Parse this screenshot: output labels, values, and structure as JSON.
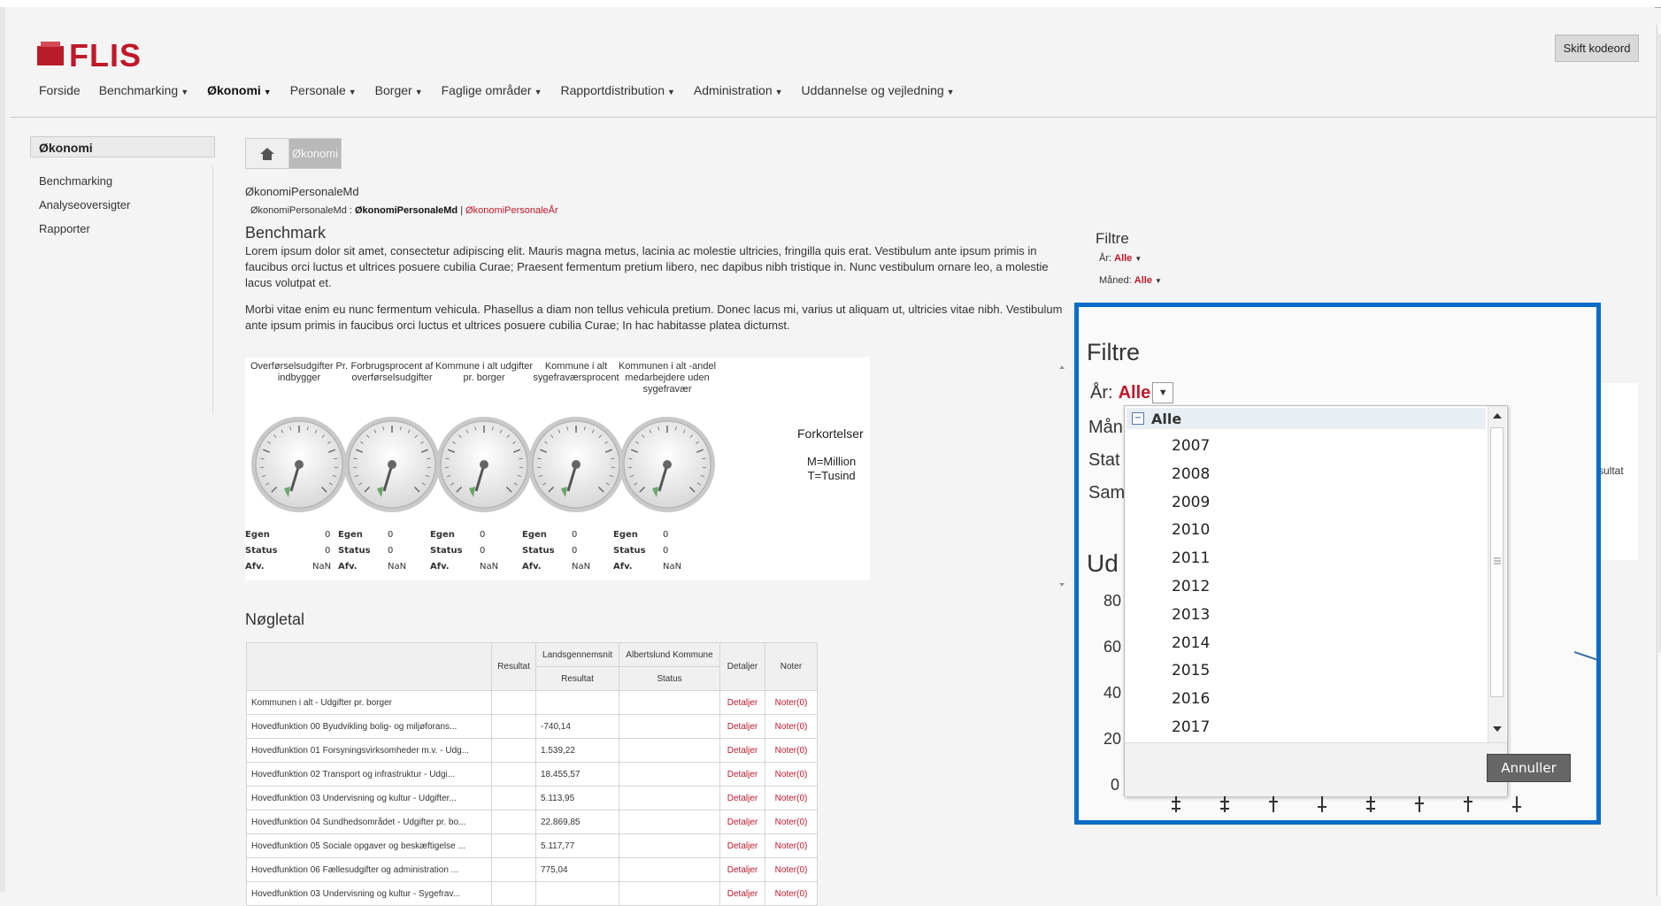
{
  "brand": {
    "name": "FLIS"
  },
  "header": {
    "switch_button": "Skift kodeord"
  },
  "nav": {
    "items": [
      {
        "label": "Forside",
        "caret": false,
        "active": false
      },
      {
        "label": "Benchmarking",
        "caret": true,
        "active": false
      },
      {
        "label": "Økonomi",
        "caret": true,
        "active": true
      },
      {
        "label": "Personale",
        "caret": true,
        "active": false
      },
      {
        "label": "Borger",
        "caret": true,
        "active": false
      },
      {
        "label": "Faglige områder",
        "caret": true,
        "active": false
      },
      {
        "label": "Rapportdistribution",
        "caret": true,
        "active": false
      },
      {
        "label": "Administration",
        "caret": true,
        "active": false
      },
      {
        "label": "Uddannelse og vejledning",
        "caret": true,
        "active": false
      }
    ]
  },
  "sidebar": {
    "title": "Økonomi",
    "items": [
      {
        "label": "Benchmarking"
      },
      {
        "label": "Analyseoversigter"
      },
      {
        "label": "Rapporter"
      }
    ]
  },
  "breadcrumb": {
    "current": "Økonomi"
  },
  "page": {
    "title": "ØkonomiPersonaleMd",
    "subtitle_prefix": "ØkonomiPersonaleMd : ",
    "subtitle_bold": "ØkonomiPersonaleMd",
    "subtitle_sep": " | ",
    "subtitle_link": "ØkonomiPersonaleÅr"
  },
  "benchmark": {
    "heading": "Benchmark",
    "para1": "Lorem ipsum dolor sit amet, consectetur adipiscing elit. Mauris magna metus, lacinia ac molestie ultricies, fringilla quis erat. Vestibulum ante ipsum primis in faucibus orci luctus et ultrices posuere cubilia Curae; Praesent fermentum pretium libero, nec dapibus nibh tristique in. Nunc vestibulum ornare leo, a molestie lacus volutpat et.",
    "para2": "Morbi vitae enim eu nunc fermentum vehicula. Phasellus a diam non tellus vehicula pretium. Donec lacus mi, varius ut aliquam ut, ultricies vitae nibh. Vestibulum ante ipsum primis in faucibus orci luctus et ultrices posuere cubilia Curae; In hac habitasse platea dictumst."
  },
  "gauges": [
    {
      "title": "Overførselsudgifter Pr. indbygger",
      "egen": "0",
      "status": "0",
      "afv": "NaN"
    },
    {
      "title": "Forbrugsprocent af overførselsudgifter",
      "egen": "0",
      "status": "0",
      "afv": "NaN"
    },
    {
      "title": "Kommune i alt udgifter pr. borger",
      "egen": "0",
      "status": "0",
      "afv": "NaN"
    },
    {
      "title": "Kommune i alt sygefraværsprocent",
      "egen": "0",
      "status": "0",
      "afv": "NaN"
    },
    {
      "title": "Kommunen i alt -andel medarbejdere uden sygefravær",
      "egen": "0",
      "status": "0",
      "afv": "NaN"
    }
  ],
  "gauge_labels": {
    "egen": "Egen",
    "status": "Status",
    "afv": "Afv."
  },
  "abbreviations": {
    "title": "Forkortelser",
    "line1": "M=Million",
    "line2": "T=Tusind"
  },
  "filters": {
    "heading": "Filtre",
    "year_label": "År:",
    "year_value": "Alle",
    "month_label": "Måned:",
    "month_value": "Alle"
  },
  "behind_text": "sultat",
  "zoom": {
    "heading": "Filtre",
    "year_label": "År:",
    "year_value": "Alle",
    "partials": [
      "Mån",
      "Stat",
      "Sam"
    ],
    "chart_heading": "Ud",
    "axis_ticks": [
      "80",
      "60",
      "40",
      "20",
      "0"
    ]
  },
  "dropdown": {
    "all_label": "Alle",
    "years": [
      "2007",
      "2008",
      "2009",
      "2010",
      "2011",
      "2012",
      "2013",
      "2014",
      "2015",
      "2016",
      "2017"
    ],
    "cancel": "Annuller"
  },
  "noegletal": {
    "heading": "Nøgletal",
    "headers": {
      "resultat": "Resultat",
      "lands": "Landsgennemsnit",
      "alberts": "Albertslund Kommune",
      "detaljer": "Detaljer",
      "noter": "Noter",
      "sub_resultat": "Resultat",
      "sub_status": "Status"
    },
    "rows": [
      {
        "label": "Kommunen i alt - Udgifter pr. borger",
        "value": "",
        "detaljer": "Detaljer",
        "noter": "Noter(0)"
      },
      {
        "label": "Hovedfunktion 00 Byudvikling bolig- og miljøforans...",
        "value": "-740,14",
        "detaljer": "Detaljer",
        "noter": "Noter(0)"
      },
      {
        "label": "Hovedfunktion 01 Forsyningsvirksomheder m.v. - Udg...",
        "value": "1.539,22",
        "detaljer": "Detaljer",
        "noter": "Noter(0)"
      },
      {
        "label": "Hovedfunktion 02 Transport og infrastruktur - Udgi...",
        "value": "18.455,57",
        "detaljer": "Detaljer",
        "noter": "Noter(0)"
      },
      {
        "label": "Hovedfunktion 03 Undervisning og kultur - Udgifter...",
        "value": "5.113,95",
        "detaljer": "Detaljer",
        "noter": "Noter(0)"
      },
      {
        "label": "Hovedfunktion 04 Sundhedsområdet - Udgifter pr. bo...",
        "value": "22.869,85",
        "detaljer": "Detaljer",
        "noter": "Noter(0)"
      },
      {
        "label": "Hovedfunktion 05 Sociale opgaver og beskæftigelse ...",
        "value": "5.117,77",
        "detaljer": "Detaljer",
        "noter": "Noter(0)"
      },
      {
        "label": "Hovedfunktion 06 Fællesudgifter og administration ...",
        "value": "775,04",
        "detaljer": "Detaljer",
        "noter": "Noter(0)"
      },
      {
        "label": "Hovedfunktion 03 Undervisning og kultur - Sygefrav...",
        "value": "",
        "detaljer": "Detaljer",
        "noter": "Noter(0)"
      }
    ]
  }
}
